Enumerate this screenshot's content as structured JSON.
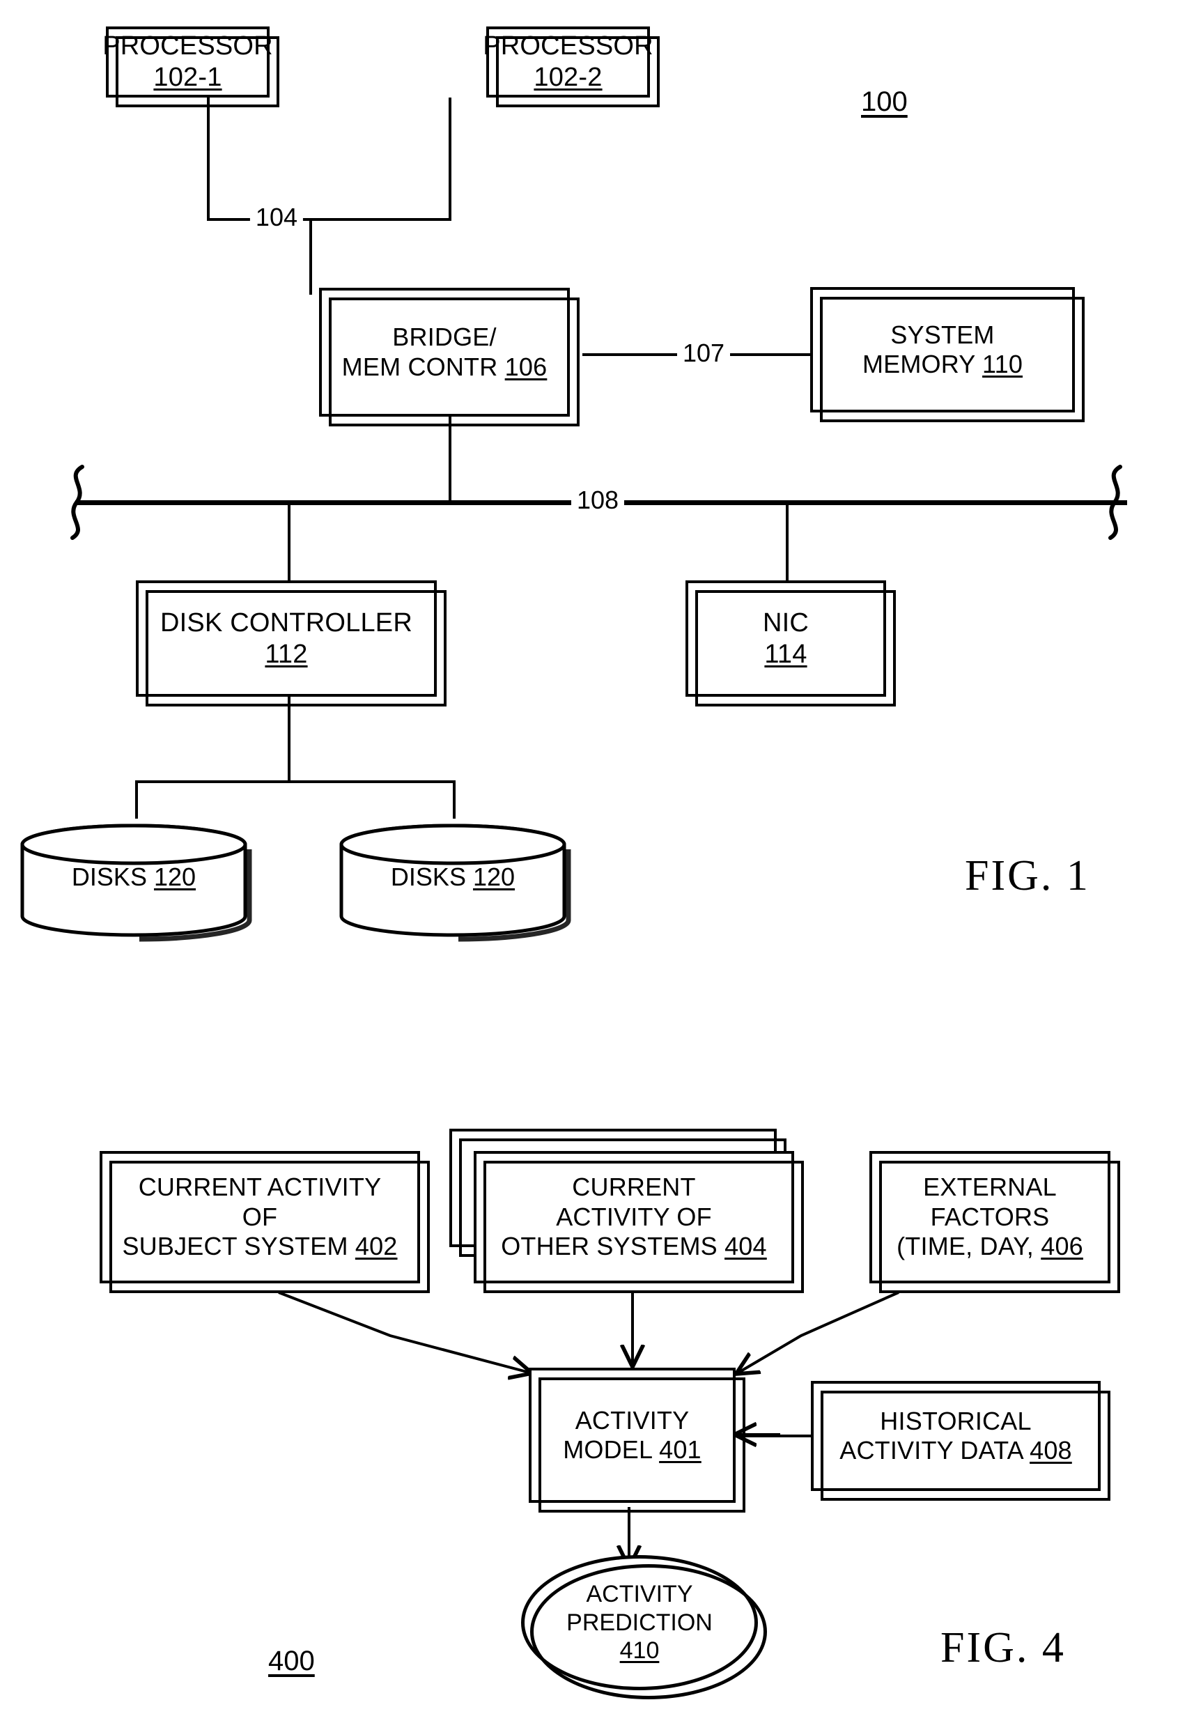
{
  "figure1": {
    "caption": "FIG. 1",
    "system_number": "100",
    "nodes": {
      "processor1": {
        "title": "PROCESSOR",
        "ref": "102-1"
      },
      "processor2": {
        "title": "PROCESSOR",
        "ref": "102-2"
      },
      "bridge": {
        "line1": "BRIDGE/",
        "line2": "MEM CONTR",
        "ref": "106"
      },
      "system_memory": {
        "line1": "SYSTEM",
        "line2": "MEMORY",
        "ref": "110"
      },
      "disk_controller": {
        "title": "DISK CONTROLLER",
        "ref": "112"
      },
      "nic": {
        "title": "NIC",
        "ref": "114"
      },
      "disks_left": {
        "title": "DISKS",
        "ref": "120"
      },
      "disks_right": {
        "title": "DISKS",
        "ref": "120"
      }
    },
    "connectors": {
      "processor_bus": "104",
      "memory_bus": "107",
      "io_bus": "108"
    }
  },
  "figure4": {
    "caption": "FIG. 4",
    "system_number": "400",
    "nodes": {
      "current_activity_subject": {
        "line1": "CURRENT ACTIVITY",
        "line2": "OF",
        "line3": "SUBJECT SYSTEM",
        "ref": "402"
      },
      "current_activity_other": {
        "line1": "CURRENT",
        "line2": "ACTIVITY OF",
        "line3": "OTHER SYSTEMS",
        "ref": "404"
      },
      "external_factors": {
        "line1": "EXTERNAL",
        "line2": "FACTORS",
        "line3": "(TIME, DAY,",
        "ref": "406"
      },
      "activity_model": {
        "line1": "ACTIVITY",
        "line2": "MODEL",
        "ref": "401"
      },
      "historical_activity_data": {
        "line1": "HISTORICAL",
        "line2": "ACTIVITY DATA",
        "ref": "408"
      },
      "activity_prediction": {
        "line1": "ACTIVITY",
        "line2": "PREDICTION",
        "ref": "410"
      }
    }
  },
  "colors": {
    "ink": "#000000",
    "paper": "#ffffff"
  }
}
